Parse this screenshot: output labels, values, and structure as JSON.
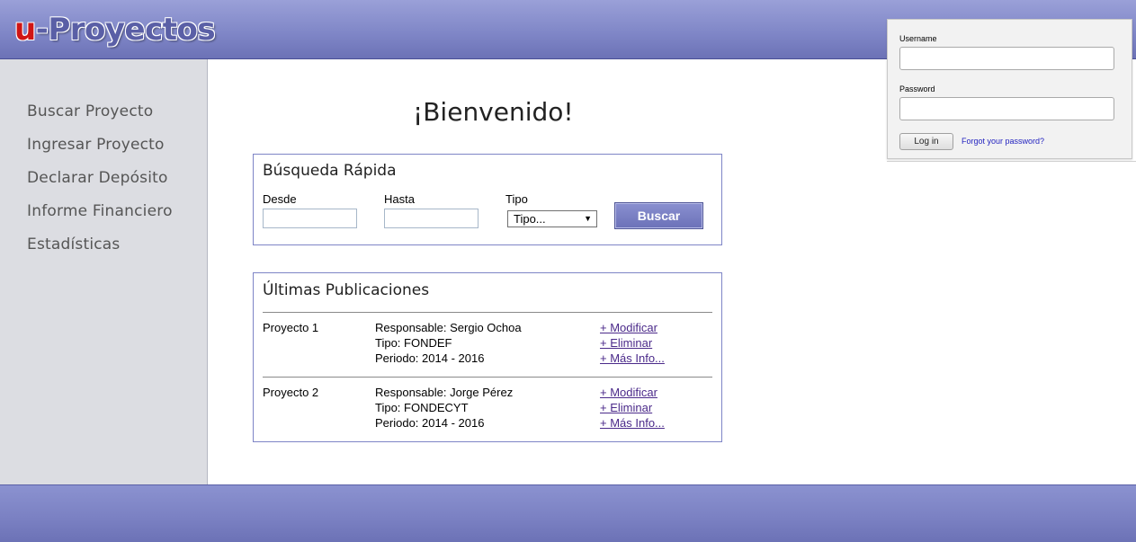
{
  "header": {
    "logo_u": "u",
    "logo_rest": "-Proyectos"
  },
  "sidebar": {
    "items": [
      {
        "label": "Buscar Proyecto"
      },
      {
        "label": "Ingresar Proyecto"
      },
      {
        "label": "Declarar Depósito"
      },
      {
        "label": "Informe Financiero"
      },
      {
        "label": "Estadísticas"
      }
    ]
  },
  "main": {
    "welcome": "¡Bienvenido!",
    "search": {
      "title": "Búsqueda Rápida",
      "desde_label": "Desde",
      "desde_value": "",
      "hasta_label": "Hasta",
      "hasta_value": "",
      "tipo_label": "Tipo",
      "tipo_selected": "Tipo...",
      "button": "Buscar"
    },
    "publications": {
      "title": "Últimas Publicaciones",
      "items": [
        {
          "name": "Proyecto 1",
          "responsable": "Responsable: Sergio Ochoa",
          "tipo": "Tipo: FONDEF",
          "periodo": "Periodo: 2014 - 2016",
          "link_modificar": "+ Modificar",
          "link_eliminar": "+ Eliminar",
          "link_info": "+ Más Info..."
        },
        {
          "name": "Proyecto 2",
          "responsable": "Responsable: Jorge Pérez",
          "tipo": "Tipo: FONDECYT",
          "periodo": "Periodo: 2014 - 2016",
          "link_modificar": "+ Modificar",
          "link_eliminar": "+ Eliminar",
          "link_info": "+ Más Info..."
        }
      ]
    }
  },
  "login": {
    "username_label": "Username",
    "username_value": "",
    "password_label": "Password",
    "password_value": "",
    "button": "Log in",
    "forgot": "Forgot your password?"
  },
  "colors": {
    "header_bg": "#7e85c6",
    "accent": "#6b71b8",
    "link": "#4b2a8a",
    "logo_u": "#d01515"
  }
}
